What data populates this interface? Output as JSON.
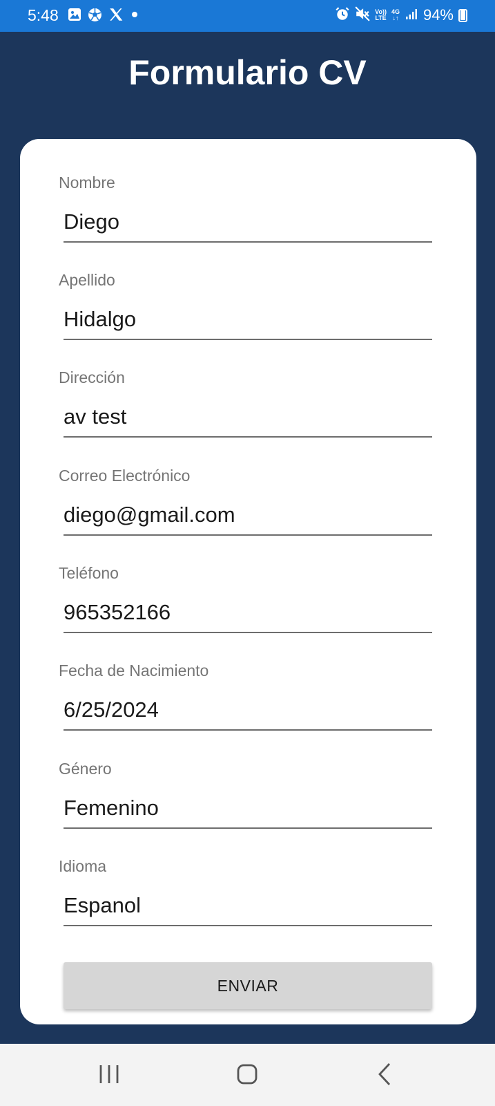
{
  "status_bar": {
    "time": "5:48",
    "battery": "94%",
    "left_icons": [
      "image-icon",
      "soccer-ball-icon",
      "x-logo-icon",
      "dot-icon"
    ],
    "right_icons": [
      "alarm-icon",
      "mute-icon",
      "volte-icon",
      "4g-icon",
      "signal-icon",
      "battery-icon"
    ],
    "volte_top": "Vo))",
    "volte_bottom": "LTE",
    "net_top": "4G",
    "net_bottom": "↓↑"
  },
  "header": {
    "title": "Formulario CV"
  },
  "form": {
    "fields": [
      {
        "label": "Nombre",
        "value": "Diego"
      },
      {
        "label": "Apellido",
        "value": "Hidalgo"
      },
      {
        "label": "Dirección",
        "value": "av test"
      },
      {
        "label": "Correo Electrónico",
        "value": "diego@gmail.com"
      },
      {
        "label": "Teléfono",
        "value": "965352166"
      },
      {
        "label": "Fecha de Nacimiento",
        "value": "6/25/2024"
      },
      {
        "label": "Género",
        "value": "Femenino"
      },
      {
        "label": "Idioma",
        "value": "Espanol"
      }
    ],
    "submit_label": "ENVIAR"
  },
  "nav_bar": {
    "items": [
      "recent-apps-icon",
      "home-icon",
      "back-icon"
    ]
  },
  "colors": {
    "status_bar": "#1a78d6",
    "background": "#1c365b",
    "card": "#ffffff",
    "button": "#d6d6d6"
  }
}
